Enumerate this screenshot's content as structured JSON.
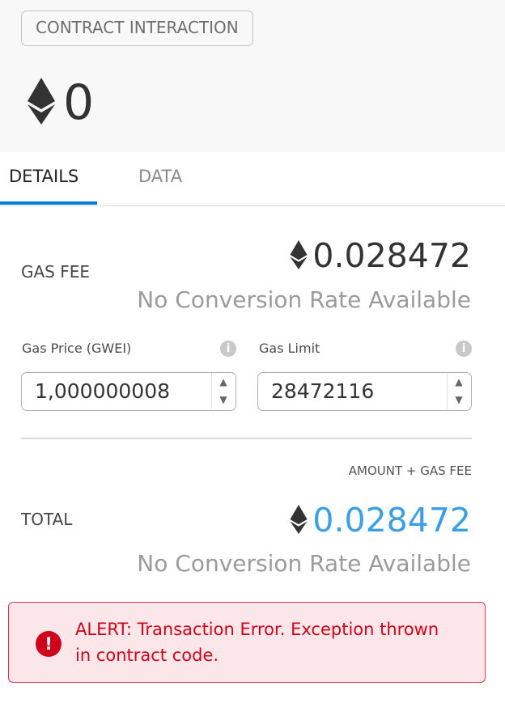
{
  "header": {
    "badge_label": "CONTRACT INTERACTION",
    "amount": "0"
  },
  "tabs": [
    {
      "label": "DETAILS",
      "active": true
    },
    {
      "label": "DATA",
      "active": false
    }
  ],
  "gas_fee": {
    "label": "GAS FEE",
    "value": "0.028472",
    "conversion": "No Conversion Rate Available"
  },
  "fields": {
    "gas_price": {
      "label": "Gas Price (GWEI)",
      "value": "1,000000008"
    },
    "gas_limit": {
      "label": "Gas Limit",
      "value": "28472116"
    }
  },
  "total": {
    "hint": "AMOUNT + GAS FEE",
    "label": "TOTAL",
    "value": "0.028472",
    "conversion": "No Conversion Rate Available"
  },
  "alert": {
    "message": "ALERT: Transaction Error. Exception thrown in contract code."
  },
  "colors": {
    "accent_blue": "#037dd6",
    "total_blue": "#3b9ee6",
    "alert_red": "#d0021b",
    "alert_bg": "#fbe7e9"
  },
  "icons": [
    "eth-icon",
    "info-icon",
    "chevron-up-icon",
    "chevron-down-icon",
    "alert-icon"
  ]
}
